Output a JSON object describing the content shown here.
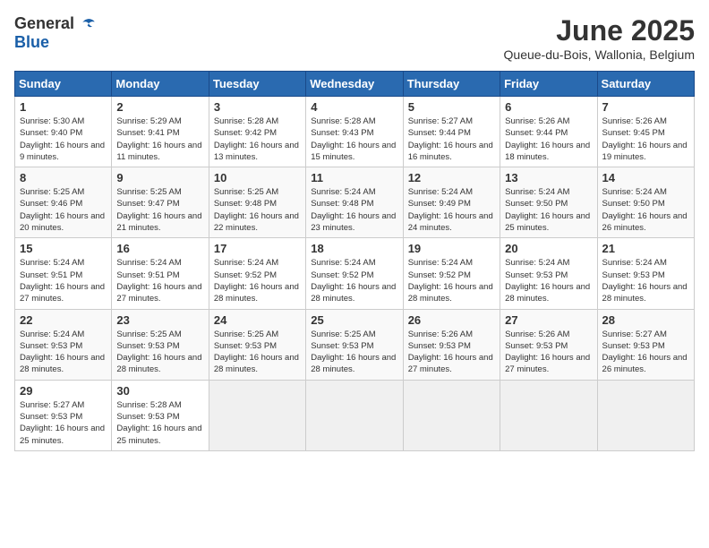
{
  "logo": {
    "general": "General",
    "blue": "Blue"
  },
  "title": "June 2025",
  "subtitle": "Queue-du-Bois, Wallonia, Belgium",
  "days_header": [
    "Sunday",
    "Monday",
    "Tuesday",
    "Wednesday",
    "Thursday",
    "Friday",
    "Saturday"
  ],
  "weeks": [
    [
      {
        "day": "1",
        "sunrise": "5:30 AM",
        "sunset": "9:40 PM",
        "daylight": "16 hours and 9 minutes."
      },
      {
        "day": "2",
        "sunrise": "5:29 AM",
        "sunset": "9:41 PM",
        "daylight": "16 hours and 11 minutes."
      },
      {
        "day": "3",
        "sunrise": "5:28 AM",
        "sunset": "9:42 PM",
        "daylight": "16 hours and 13 minutes."
      },
      {
        "day": "4",
        "sunrise": "5:28 AM",
        "sunset": "9:43 PM",
        "daylight": "16 hours and 15 minutes."
      },
      {
        "day": "5",
        "sunrise": "5:27 AM",
        "sunset": "9:44 PM",
        "daylight": "16 hours and 16 minutes."
      },
      {
        "day": "6",
        "sunrise": "5:26 AM",
        "sunset": "9:44 PM",
        "daylight": "16 hours and 18 minutes."
      },
      {
        "day": "7",
        "sunrise": "5:26 AM",
        "sunset": "9:45 PM",
        "daylight": "16 hours and 19 minutes."
      }
    ],
    [
      {
        "day": "8",
        "sunrise": "5:25 AM",
        "sunset": "9:46 PM",
        "daylight": "16 hours and 20 minutes."
      },
      {
        "day": "9",
        "sunrise": "5:25 AM",
        "sunset": "9:47 PM",
        "daylight": "16 hours and 21 minutes."
      },
      {
        "day": "10",
        "sunrise": "5:25 AM",
        "sunset": "9:48 PM",
        "daylight": "16 hours and 22 minutes."
      },
      {
        "day": "11",
        "sunrise": "5:24 AM",
        "sunset": "9:48 PM",
        "daylight": "16 hours and 23 minutes."
      },
      {
        "day": "12",
        "sunrise": "5:24 AM",
        "sunset": "9:49 PM",
        "daylight": "16 hours and 24 minutes."
      },
      {
        "day": "13",
        "sunrise": "5:24 AM",
        "sunset": "9:50 PM",
        "daylight": "16 hours and 25 minutes."
      },
      {
        "day": "14",
        "sunrise": "5:24 AM",
        "sunset": "9:50 PM",
        "daylight": "16 hours and 26 minutes."
      }
    ],
    [
      {
        "day": "15",
        "sunrise": "5:24 AM",
        "sunset": "9:51 PM",
        "daylight": "16 hours and 27 minutes."
      },
      {
        "day": "16",
        "sunrise": "5:24 AM",
        "sunset": "9:51 PM",
        "daylight": "16 hours and 27 minutes."
      },
      {
        "day": "17",
        "sunrise": "5:24 AM",
        "sunset": "9:52 PM",
        "daylight": "16 hours and 28 minutes."
      },
      {
        "day": "18",
        "sunrise": "5:24 AM",
        "sunset": "9:52 PM",
        "daylight": "16 hours and 28 minutes."
      },
      {
        "day": "19",
        "sunrise": "5:24 AM",
        "sunset": "9:52 PM",
        "daylight": "16 hours and 28 minutes."
      },
      {
        "day": "20",
        "sunrise": "5:24 AM",
        "sunset": "9:53 PM",
        "daylight": "16 hours and 28 minutes."
      },
      {
        "day": "21",
        "sunrise": "5:24 AM",
        "sunset": "9:53 PM",
        "daylight": "16 hours and 28 minutes."
      }
    ],
    [
      {
        "day": "22",
        "sunrise": "5:24 AM",
        "sunset": "9:53 PM",
        "daylight": "16 hours and 28 minutes."
      },
      {
        "day": "23",
        "sunrise": "5:25 AM",
        "sunset": "9:53 PM",
        "daylight": "16 hours and 28 minutes."
      },
      {
        "day": "24",
        "sunrise": "5:25 AM",
        "sunset": "9:53 PM",
        "daylight": "16 hours and 28 minutes."
      },
      {
        "day": "25",
        "sunrise": "5:25 AM",
        "sunset": "9:53 PM",
        "daylight": "16 hours and 28 minutes."
      },
      {
        "day": "26",
        "sunrise": "5:26 AM",
        "sunset": "9:53 PM",
        "daylight": "16 hours and 27 minutes."
      },
      {
        "day": "27",
        "sunrise": "5:26 AM",
        "sunset": "9:53 PM",
        "daylight": "16 hours and 27 minutes."
      },
      {
        "day": "28",
        "sunrise": "5:27 AM",
        "sunset": "9:53 PM",
        "daylight": "16 hours and 26 minutes."
      }
    ],
    [
      {
        "day": "29",
        "sunrise": "5:27 AM",
        "sunset": "9:53 PM",
        "daylight": "16 hours and 25 minutes."
      },
      {
        "day": "30",
        "sunrise": "5:28 AM",
        "sunset": "9:53 PM",
        "daylight": "16 hours and 25 minutes."
      },
      null,
      null,
      null,
      null,
      null
    ]
  ],
  "labels": {
    "sunrise": "Sunrise:",
    "sunset": "Sunset:",
    "daylight": "Daylight:"
  }
}
